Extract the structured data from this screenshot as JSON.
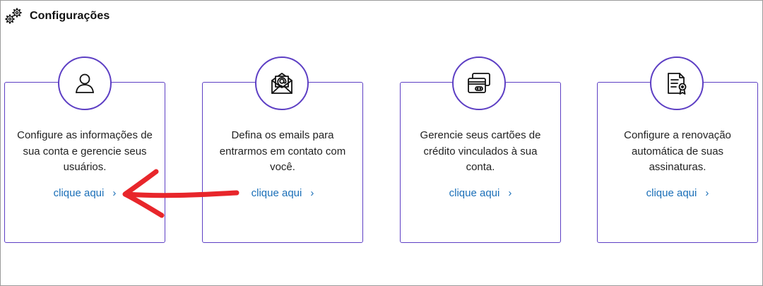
{
  "header": {
    "title": "Configurações",
    "icon": "gears-icon"
  },
  "cards": [
    {
      "icon": "user-icon",
      "description": "Configure as informações de sua conta e gerencie seus usuários.",
      "link": "clique aqui",
      "chevron": "›"
    },
    {
      "icon": "email-envelope-icon",
      "description": "Defina os emails para entrarmos em contato com você.",
      "link": "clique aqui",
      "chevron": "›"
    },
    {
      "icon": "credit-cards-icon",
      "description": "Gerencie seus cartões de crédito vinculados à sua conta.",
      "link": "clique aqui",
      "chevron": "›"
    },
    {
      "icon": "certificate-document-icon",
      "description": "Configure a renovação automática de suas assinaturas.",
      "link": "clique aqui",
      "chevron": "›"
    }
  ],
  "colors": {
    "accent": "#5d3fc4",
    "link": "#1b6fb8",
    "annotation_arrow": "#e8262b"
  }
}
